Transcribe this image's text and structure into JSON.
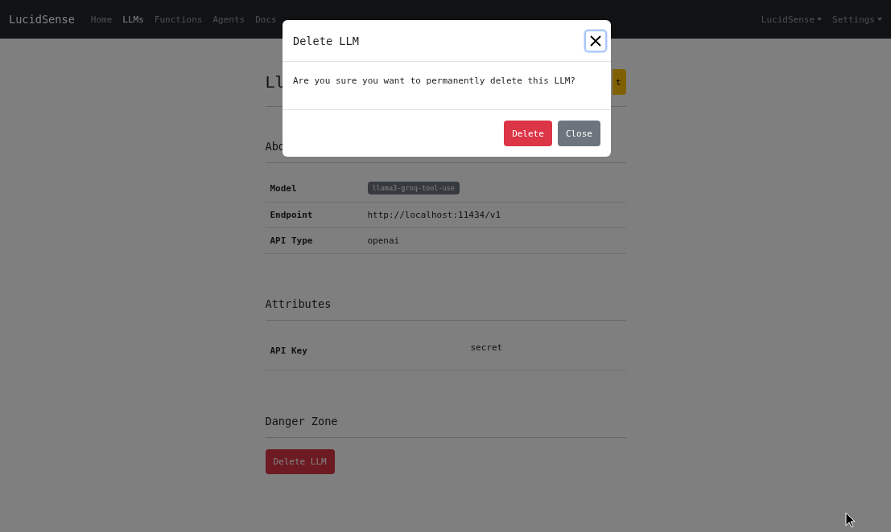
{
  "navbar": {
    "brand": "LucidSense",
    "links": [
      {
        "label": "Home",
        "selected": false
      },
      {
        "label": "LLMs",
        "selected": true
      },
      {
        "label": "Functions",
        "selected": false
      },
      {
        "label": "Agents",
        "selected": false
      },
      {
        "label": "Docs",
        "selected": false
      }
    ],
    "menus": [
      "LucidSense",
      "Settings"
    ]
  },
  "page": {
    "title": "Ll",
    "edit_button": "t",
    "about": {
      "heading": "Abo",
      "rows": [
        {
          "label": "Model",
          "value": "llama3-groq-tool-use",
          "kind": "badge"
        },
        {
          "label": "Endpoint",
          "value": "http://localhost:11434/v1",
          "kind": "text"
        },
        {
          "label": "API Type",
          "value": "openai",
          "kind": "text"
        }
      ]
    },
    "attributes": {
      "heading": "Attributes",
      "rows": [
        {
          "label": "API Key",
          "value": "secret"
        }
      ]
    },
    "danger_zone": {
      "heading": "Danger Zone",
      "button": "Delete LLM"
    }
  },
  "modal": {
    "title": "Delete LLM",
    "body": "Are you sure you want to permanently delete this LLM?",
    "buttons": [
      {
        "label": "Delete",
        "kind": "danger"
      },
      {
        "label": "Close",
        "kind": "secondary"
      }
    ]
  }
}
